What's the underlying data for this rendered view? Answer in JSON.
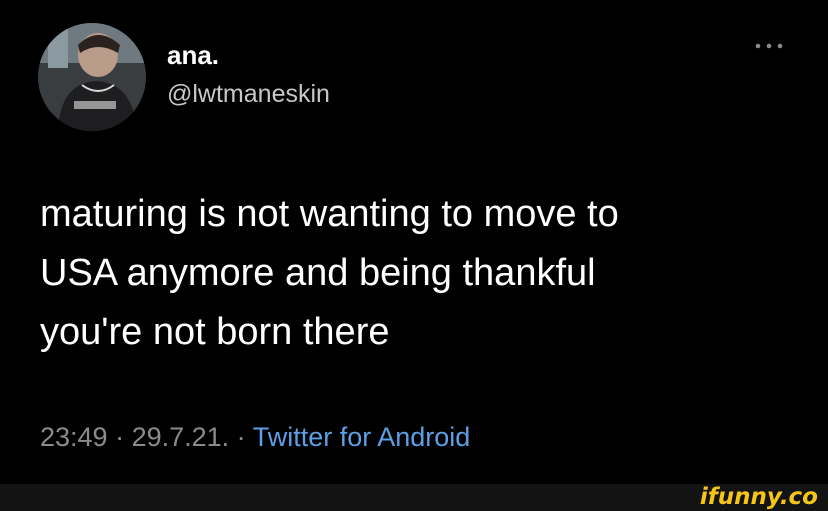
{
  "author": {
    "display_name": "ana.",
    "handle": "@lwtmaneskin",
    "avatar_icon": "avatar-photo"
  },
  "more_icon": "more-dots-icon",
  "tweet": {
    "lines": [
      "maturing is not wanting to move to",
      "USA anymore and being thankful",
      "you're not born there"
    ]
  },
  "meta": {
    "time": "23:49",
    "separator": " · ",
    "date": "29.7.21.",
    "separator2": " · ",
    "source": "Twitter for Android"
  },
  "watermark": {
    "text": "ifunny.co"
  },
  "colors": {
    "background": "#000000",
    "text": "#ffffff",
    "muted": "#8b8b8b",
    "link": "#5c9fe6",
    "watermark": "#f5c518"
  }
}
